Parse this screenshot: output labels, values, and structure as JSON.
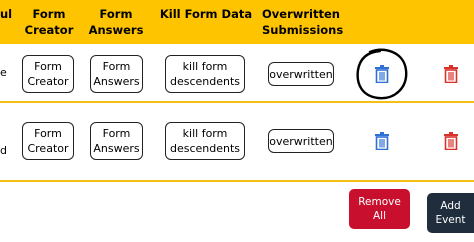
{
  "header": {
    "partial_col": "ul",
    "columns": [
      {
        "line1": "Form",
        "line2": "Creator"
      },
      {
        "line1": "Form",
        "line2": "Answers"
      },
      {
        "line1": "Kill Form Data",
        "line2": ""
      },
      {
        "line1": "Overwritten",
        "line2": "Submissions"
      }
    ]
  },
  "rows": [
    {
      "edge_text": "e",
      "form_creator": {
        "line1": "Form",
        "line2": "Creator"
      },
      "form_answers": {
        "line1": "Form",
        "line2": "Answers"
      },
      "kill": {
        "line1": "kill form",
        "line2": "descendents"
      },
      "overwritten": "overwritten",
      "icons": [
        "trash-icon-blue",
        "trash-icon-red"
      ]
    },
    {
      "edge_text": "d",
      "form_creator": {
        "line1": "Form",
        "line2": "Creator"
      },
      "form_answers": {
        "line1": "Form",
        "line2": "Answers"
      },
      "kill": {
        "line1": "kill form",
        "line2": "descendents"
      },
      "overwritten": "overwritten",
      "icons": [
        "trash-icon-blue",
        "trash-icon-red"
      ]
    }
  ],
  "actions": {
    "remove_all": {
      "line1": "Remove",
      "line2": "All"
    },
    "add_event": {
      "line1": "Add",
      "line2": "Event"
    }
  },
  "colors": {
    "header_bg": "#ffc400",
    "blue_icon": "#2f6fd6",
    "red_icon": "#d9322b",
    "remove_bg": "#c8102e",
    "add_bg": "#1f2d3d"
  }
}
